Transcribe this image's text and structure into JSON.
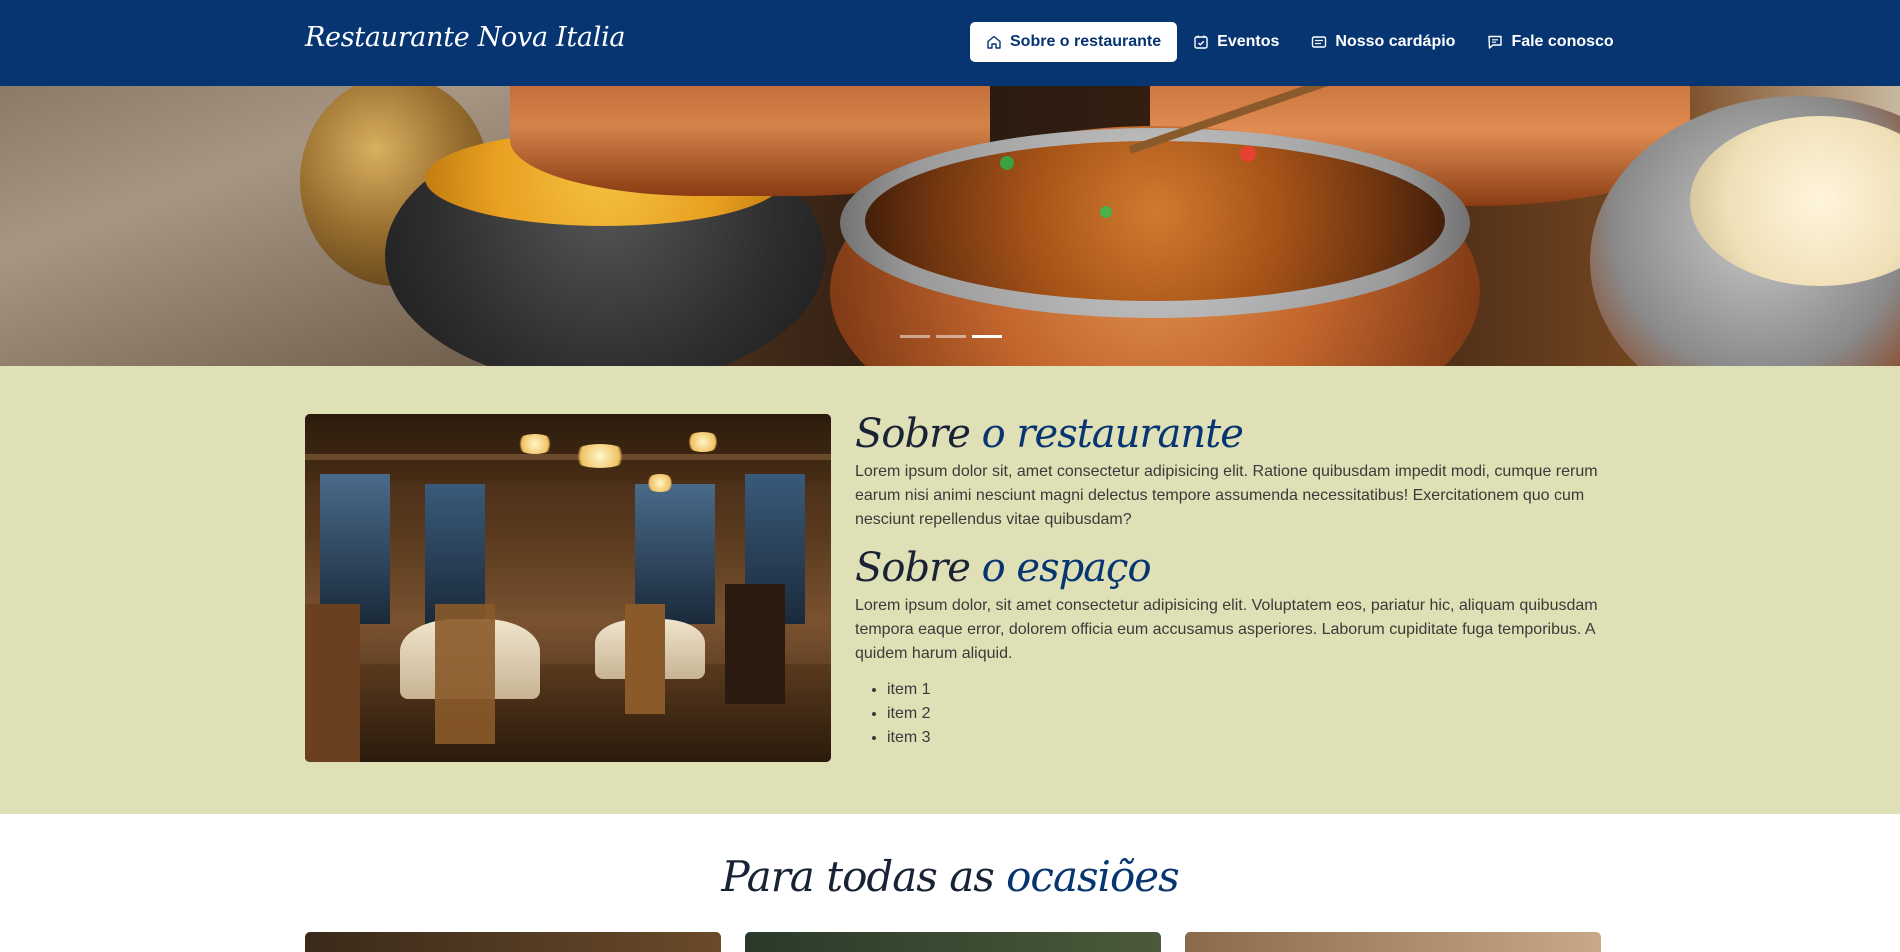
{
  "nav": {
    "brand": "Restaurante Nova Italia",
    "links": [
      {
        "label": "Sobre o restaurante",
        "icon": "home-icon",
        "active": true
      },
      {
        "label": "Eventos",
        "icon": "calendar-check-icon",
        "active": false
      },
      {
        "label": "Nosso cardápio",
        "icon": "menu-card-icon",
        "active": false
      },
      {
        "label": "Fale conosco",
        "icon": "chat-icon",
        "active": false
      }
    ]
  },
  "hero": {
    "slide_count": 3,
    "active_slide": 3
  },
  "about": {
    "restaurant": {
      "title_prefix": "Sobre",
      "title_accent": "o restaurante",
      "text": "Lorem ipsum dolor sit, amet consectetur adipisicing elit. Ratione quibusdam impedit modi, cumque rerum earum nisi animi nesciunt magni delectus tempore assumenda necessitatibus! Exercitationem quo cum nesciunt repellendus vitae quibusdam?"
    },
    "space": {
      "title_prefix": "Sobre",
      "title_accent": "o espaço",
      "text": "Lorem ipsum dolor, sit amet consectetur adipisicing elit. Voluptatem eos, pariatur hic, aliquam quibusdam tempora eaque error, dolorem officia eum accusamus asperiores. Laborum cupiditate fuga temporibus. A quidem harum aliquid.",
      "items": [
        "item 1",
        "item 2",
        "item 3"
      ]
    }
  },
  "occasions": {
    "title_prefix": "Para todas as",
    "title_accent": "ocasiões"
  },
  "colors": {
    "nav_bg": "#063572",
    "about_bg": "#e0e0b6",
    "accent": "#063572"
  }
}
